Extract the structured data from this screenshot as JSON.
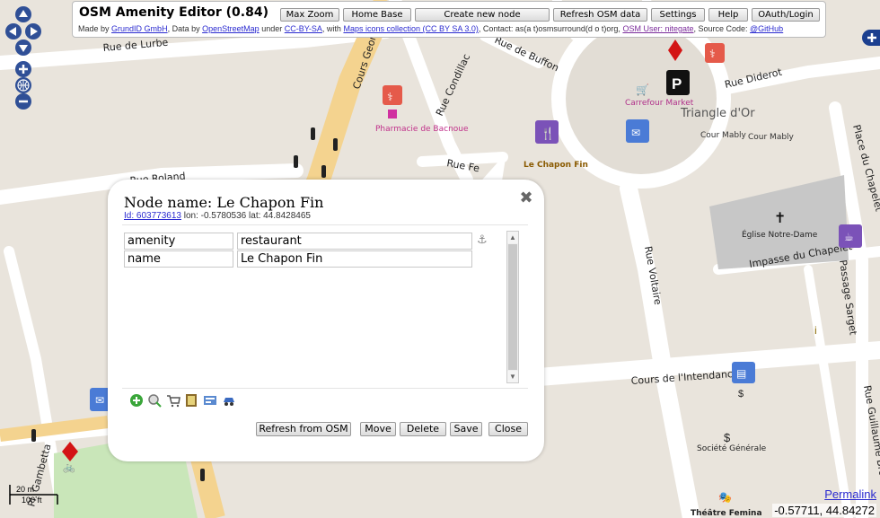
{
  "header": {
    "title": "OSM Amenity Editor (0.84)",
    "buttons": {
      "max_zoom": "Max Zoom",
      "home_base": "Home Base",
      "create_node": "Create new node",
      "refresh": "Refresh OSM data",
      "settings": "Settings",
      "help": "Help",
      "oauth": "OAuth/Login"
    },
    "credits": {
      "made_by": "Made by",
      "grundid": "GrundID GmbH",
      "data_by": ", Data by",
      "osm": "OpenStreetMap",
      "under": "under",
      "license": "CC-BY-SA",
      "with": ", with",
      "icons": "Maps icons collection (CC BY SA 3.0)",
      "contact": ", Contact: as(a t)osmsurround(d o t)org,",
      "osm_user": "OSM User: nitegate",
      "source": ", Source Code:",
      "github": "@GitHub"
    }
  },
  "map": {
    "streets": {
      "lurbe": "Rue de Lurbe",
      "cours_georges": "Cours George",
      "condillac": "Rue Condillac",
      "buffon": "Rue de Buffon",
      "diderot": "Rue Diderot",
      "roland": "Rue Roland",
      "fe": "Rue Fe",
      "voltaire": "Rue Voltaire",
      "intendance": "Cours de l'Intendance",
      "chapelet": "Impasse du Chapelet",
      "sarget": "Passage Sarget",
      "place_chapelet": "Place du Chapelet",
      "gambetta": "Pl. Gambetta",
      "brochon": "Rue Guillaume Brochon",
      "triangle": "Triangle d'Or",
      "mably1": "Cour Mably",
      "mably2": "Cour Mably"
    },
    "pois": {
      "pharmacie": "Pharmacie de Bacnoue",
      "carrefour": "Carrefour Market",
      "chapon": "Le Chapon Fin",
      "eglise": "Église Notre-Dame",
      "societe": "Société Générale",
      "theatre": "Théâtre Femina"
    }
  },
  "popup": {
    "title_prefix": "Node name:",
    "title": "Le Chapon Fin",
    "id_link": "Id: 603773613",
    "lon_label": "lon:",
    "lon": "-0.5780536",
    "lat_label": "lat:",
    "lat": "44.8428465",
    "tags": [
      {
        "key": "amenity",
        "value": "restaurant"
      },
      {
        "key": "name",
        "value": "Le Chapon Fin"
      }
    ],
    "buttons": {
      "refresh": "Refresh from OSM",
      "move": "Move",
      "delete": "Delete",
      "save": "Save",
      "close": "Close"
    },
    "icon_names": [
      "add-tag-icon",
      "search-tag-icon",
      "shop-template-icon",
      "book-template-icon",
      "contact-template-icon",
      "car-template-icon"
    ]
  },
  "scale": {
    "top": "20 m",
    "bottom": "100 ft"
  },
  "permalink": "Permalink",
  "coordinates": "-0.57711, 44.84272"
}
